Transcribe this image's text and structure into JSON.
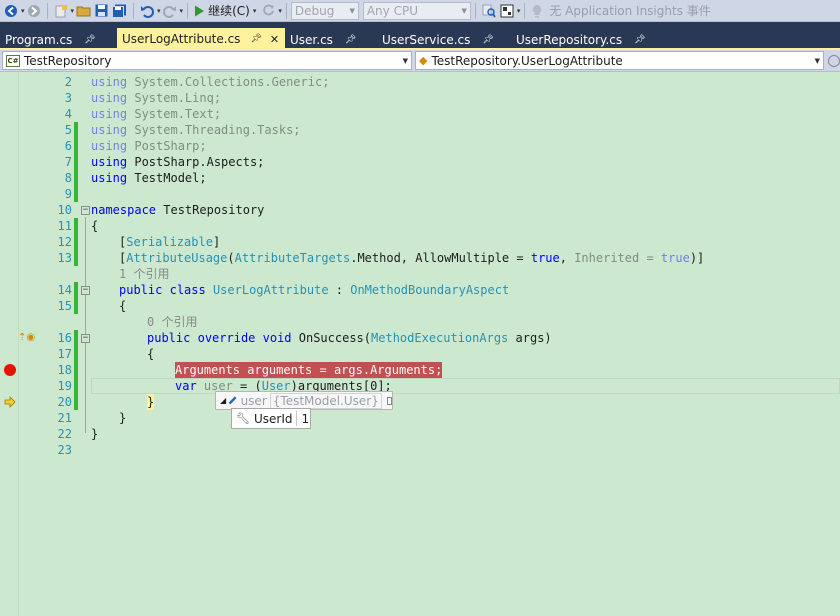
{
  "toolbar": {
    "continue_label": "继续(C)",
    "config": "Debug",
    "platform": "Any CPU",
    "insights": "无 Application Insights 事件"
  },
  "tabs": [
    {
      "label": "Program.cs",
      "active": false
    },
    {
      "label": "UserLogAttribute.cs",
      "active": true
    },
    {
      "label": "User.cs",
      "active": false
    },
    {
      "label": "UserService.cs",
      "active": false
    },
    {
      "label": "UserRepository.cs",
      "active": false
    }
  ],
  "navbar": {
    "project": "TestRepository",
    "type": "TestRepository.UserLogAttribute",
    "project_icon": "C#"
  },
  "editor": {
    "line_numbers": [
      "2",
      "3",
      "4",
      "5",
      "6",
      "7",
      "8",
      "9",
      "10",
      "11",
      "12",
      "13",
      "14",
      "15",
      "16",
      "17",
      "18",
      "19",
      "20",
      "21",
      "22",
      "23"
    ],
    "lines": {
      "l2": [
        "using",
        " System.Collections.Generic;"
      ],
      "l3": [
        "using",
        " System.Linq;"
      ],
      "l4": [
        "using",
        " System.Text;"
      ],
      "l5": [
        "using",
        " System.Threading.Tasks;"
      ],
      "l6": [
        "using",
        " PostSharp;"
      ],
      "l7": [
        "using",
        " PostSharp.Aspects;"
      ],
      "l8": [
        "using",
        " TestModel;"
      ],
      "l10": [
        "namespace",
        " TestRepository"
      ],
      "l11": "{",
      "l12": [
        "[",
        "Serializable",
        "]"
      ],
      "l13": [
        "[",
        "AttributeUsage",
        "(",
        "AttributeTargets",
        ".Method, AllowMultiple = ",
        "true",
        ", ",
        "Inherited = ",
        "true",
        ")]"
      ],
      "ref1": "1 个引用",
      "l14": [
        "public",
        " ",
        "class",
        " ",
        "UserLogAttribute",
        " : ",
        "OnMethodBoundaryAspect"
      ],
      "l15": "{",
      "ref0": "0 个引用",
      "l16": [
        "public",
        " ",
        "override",
        " ",
        "void",
        " OnSuccess(",
        "MethodExecutionArgs",
        " args)"
      ],
      "l17": "{",
      "l18": "Arguments arguments = args.Arguments;",
      "l19": [
        "var",
        " ",
        "user",
        " = (",
        "User",
        ")arguments[0];"
      ],
      "l20": "}",
      "l21": "}",
      "l22": "}"
    }
  },
  "datatip": {
    "name": "user",
    "value": "{TestModel.User}",
    "child_name": "UserId",
    "child_value": "1"
  }
}
